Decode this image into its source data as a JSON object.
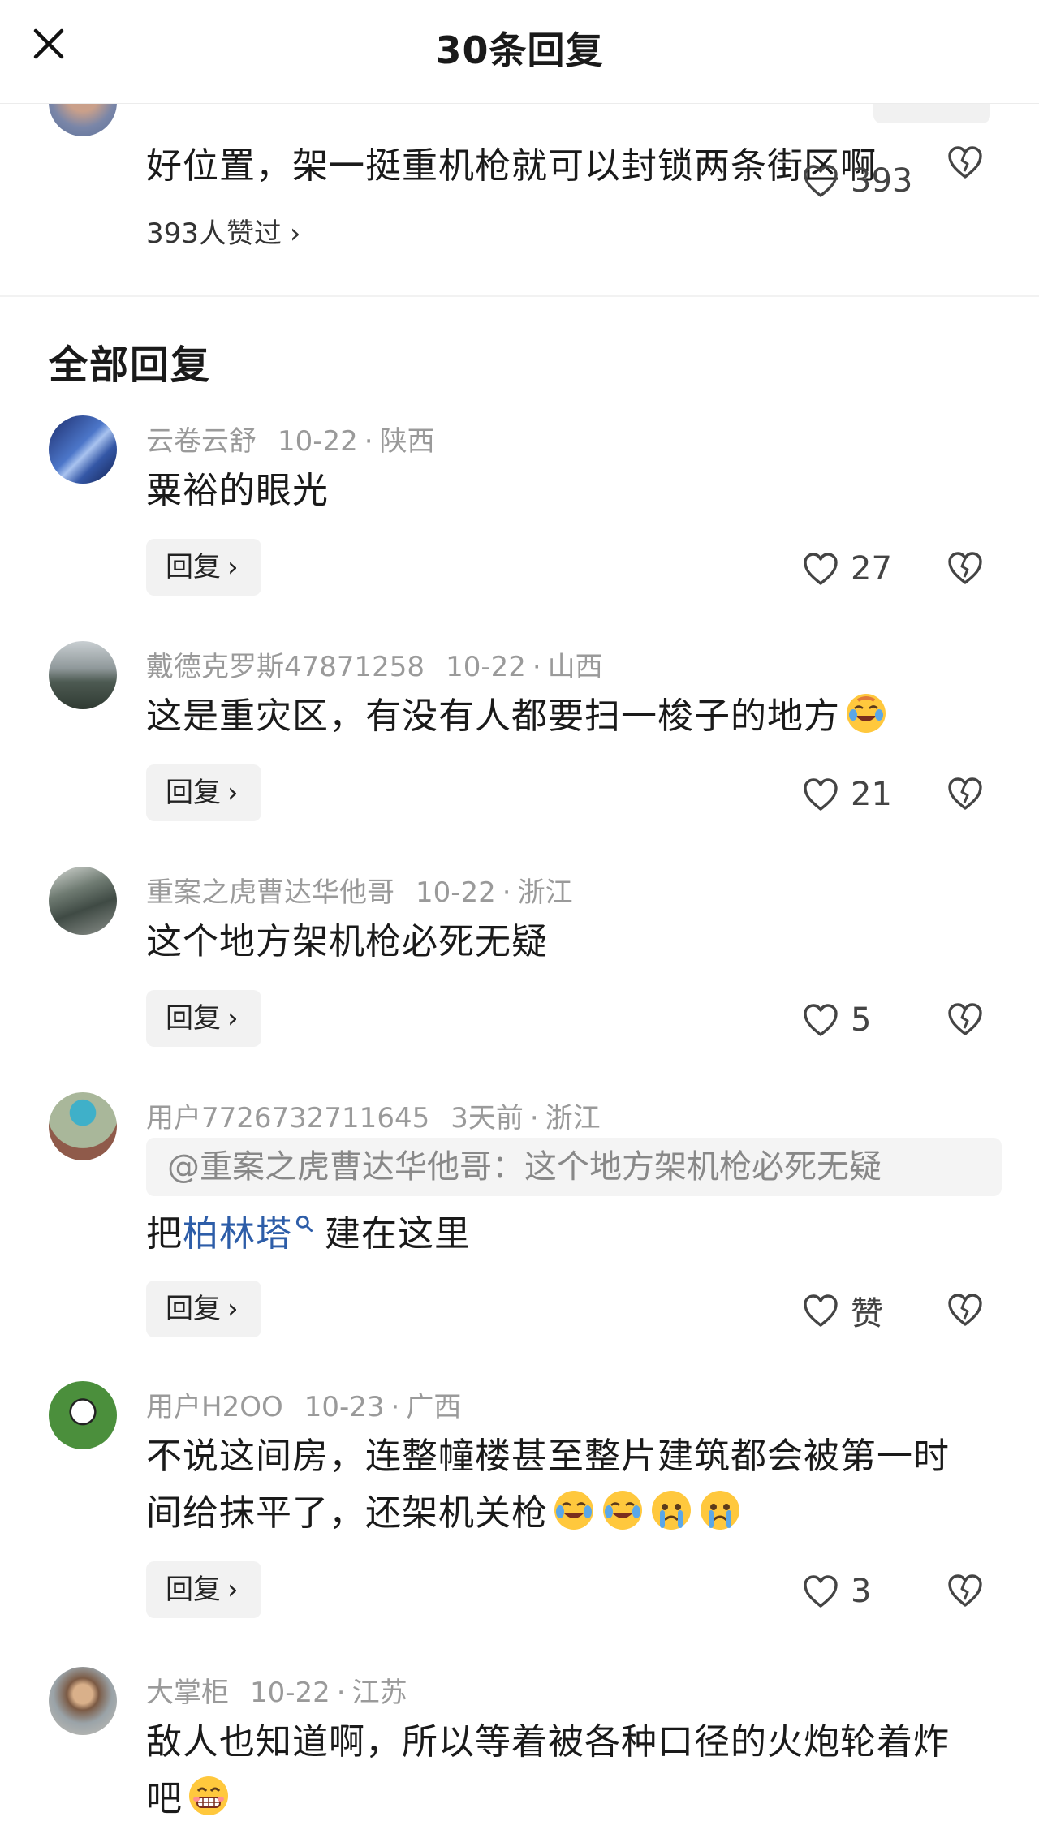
{
  "header": {
    "title": "30条回复"
  },
  "pinned": {
    "text": "好位置，架一挺重机枪就可以封锁两条街区啊",
    "liked_by": "393人赞过",
    "likes": "393"
  },
  "section_title": "全部回复",
  "reply_label": "回复",
  "comments": [
    {
      "user": "云卷云舒",
      "date": "10-22",
      "region": "陕西",
      "text": "粟裕的眼光",
      "likes": "27",
      "avatar": "building-avatar"
    },
    {
      "user": "戴德克罗斯47871258",
      "date": "10-22",
      "region": "山西",
      "text": "这是重灾区，有没有人都要扫一梭子的地方",
      "likes": "21",
      "emoji": [
        "laughing-crying-face-icon"
      ],
      "avatar": "landscape-avatar"
    },
    {
      "user": "重案之虎曹达华他哥",
      "date": "10-22",
      "region": "浙江",
      "text": "这个地方架机枪必死无疑",
      "likes": "5",
      "avatar": "street-avatar"
    },
    {
      "user": "用户7726732711645",
      "date": "3天前",
      "region": "浙江",
      "quote": "@重案之虎曹达华他哥：这个地方架机枪必死无疑",
      "text_before": "把",
      "link": "柏林塔",
      "text_after": "建在这里",
      "likes": "赞",
      "avatar": "cartoon-avatar"
    },
    {
      "user": "用户H2OO",
      "date": "10-23",
      "region": "广西",
      "text_line1": "不说这间房，连整幢楼甚至整片建筑都会被第一时",
      "text_line2": "间给抹平了，还架机关枪",
      "likes": "3",
      "emoji": [
        "tears-of-joy-icon",
        "tears-of-joy-icon",
        "crying-face-icon",
        "crying-face-icon"
      ],
      "avatar": "football-avatar"
    },
    {
      "user": "大掌柜",
      "date": "10-22",
      "region": "江苏",
      "text_line1": "敌人也知道啊，所以等着被各种口径的火炮轮着炸",
      "text_line2": "吧",
      "emoji": [
        "grinning-face-icon"
      ],
      "avatar": "artwork-avatar"
    }
  ],
  "colors": {
    "meta_gray": "#9a9a9a",
    "link_blue": "#2d5da8",
    "reply_bg": "#f2f2f2"
  },
  "icons": [
    "close-icon",
    "heart-icon",
    "broken-heart-icon",
    "chevron-right-icon",
    "search-icon"
  ]
}
